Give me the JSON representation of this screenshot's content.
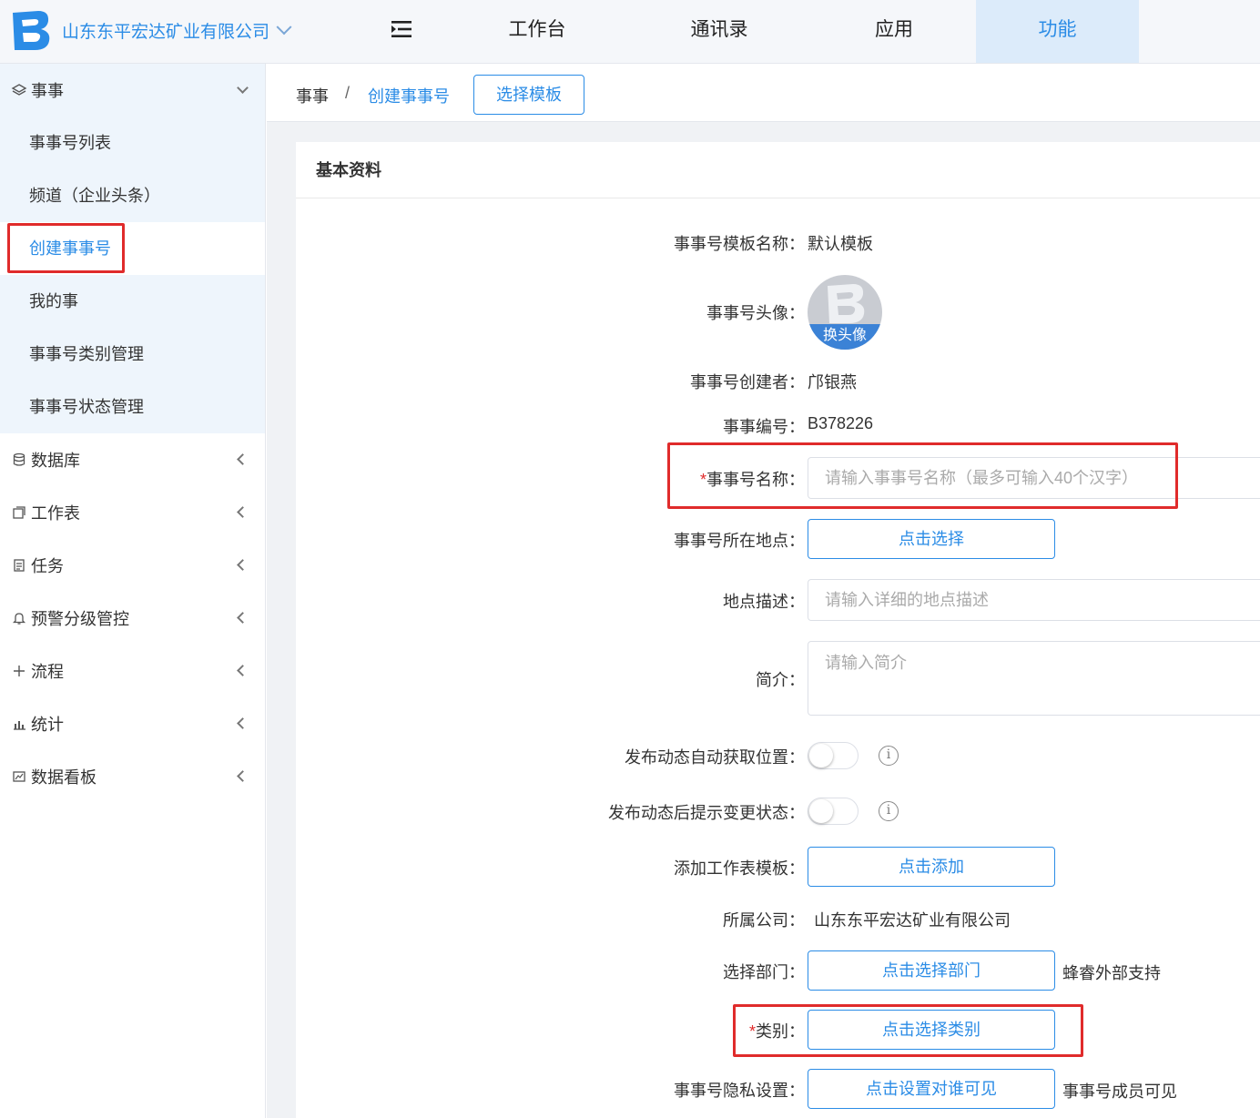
{
  "topbar": {
    "company": "山东东平宏达矿业有限公司",
    "nav": [
      "工作台",
      "通讯录",
      "应用",
      "功能"
    ],
    "active_nav": "功能"
  },
  "sidebar": {
    "open_group": {
      "label": "事事",
      "items": [
        "事事号列表",
        "频道（企业头条）",
        "创建事事号",
        "我的事",
        "事事号类别管理",
        "事事号状态管理"
      ],
      "active_item": "创建事事号"
    },
    "groups": [
      {
        "label": "数据库",
        "icon": "database-icon"
      },
      {
        "label": "工作表",
        "icon": "worksheet-icon"
      },
      {
        "label": "任务",
        "icon": "task-icon"
      },
      {
        "label": "预警分级管控",
        "icon": "bell-icon"
      },
      {
        "label": "流程",
        "icon": "plus-icon"
      },
      {
        "label": "统计",
        "icon": "bar-chart-icon"
      },
      {
        "label": "数据看板",
        "icon": "dashboard-icon"
      }
    ]
  },
  "breadcrumb": {
    "root": "事事",
    "separator": "/",
    "current": "创建事事号",
    "template_button": "选择模板"
  },
  "form": {
    "section_title": "基本资料",
    "template_name_label": "事事号模板名称：",
    "template_name_value": "默认模板",
    "avatar_label": "事事号头像：",
    "avatar_caption": "换头像",
    "creator_label": "事事号创建者：",
    "creator_value": "邝银燕",
    "number_label": "事事编号：",
    "number_value": "B378226",
    "name_required_mark": "*",
    "name_label": "事事号名称：",
    "name_placeholder": "请输入事事号名称（最多可输入40个汉字）",
    "location_label": "事事号所在地点：",
    "location_button": "点击选择",
    "location_desc_label": "地点描述：",
    "location_desc_placeholder": "请输入详细的地点描述",
    "intro_label": "简介：",
    "intro_placeholder": "请输入简介",
    "auto_location_label": "发布动态自动获取位置：",
    "auto_location_on": false,
    "status_prompt_label": "发布动态后提示变更状态：",
    "status_prompt_on": false,
    "info_glyph": "i",
    "worksheet_label": "添加工作表模板：",
    "worksheet_button": "点击添加",
    "company_label": "所属公司：",
    "company_value": "山东东平宏达矿业有限公司",
    "dept_label": "选择部门：",
    "dept_button": "点击选择部门",
    "dept_value": "蜂睿外部支持",
    "category_required_mark": "*",
    "category_label": "类别：",
    "category_button": "点击选择类别",
    "privacy_label": "事事号隐私设置：",
    "privacy_button": "点击设置对谁可见",
    "privacy_value": "事事号成员可见"
  },
  "colors": {
    "accent": "#2b8ce6",
    "highlight_box": "#e02b2b",
    "active_nav_bg": "#dcebfa"
  }
}
